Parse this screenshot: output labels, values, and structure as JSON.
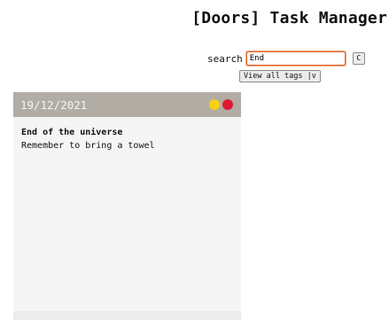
{
  "app": {
    "title": "[Doors] Task Manager"
  },
  "search": {
    "label": "search",
    "value": "End",
    "clear_label": "C"
  },
  "tags": {
    "button_label": "View all tags |v"
  },
  "note": {
    "date": "19/12/2021",
    "title": "End of the universe",
    "body": "Remember to bring a towel",
    "colors": {
      "header": "#b1ada5",
      "dot_yellow": "#f9cf12",
      "dot_red": "#e01933"
    }
  }
}
